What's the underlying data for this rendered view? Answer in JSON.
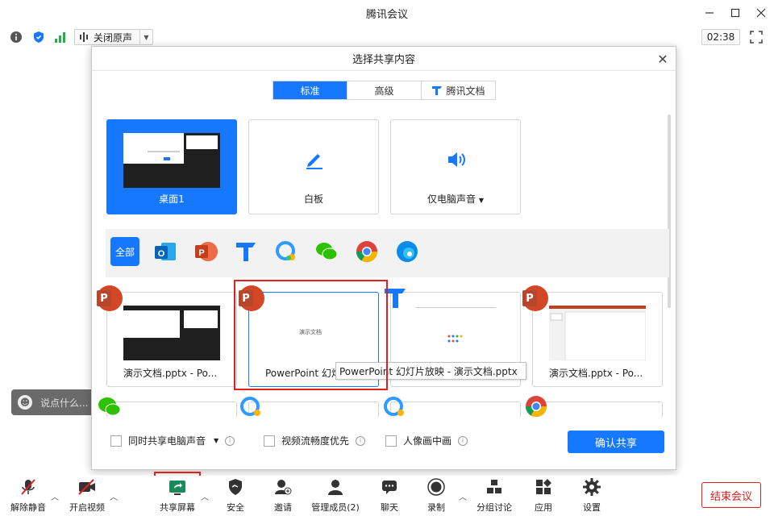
{
  "window": {
    "title": "腾讯会议"
  },
  "toolbar": {
    "noise_label": "关闭原声",
    "timer": "02:38"
  },
  "chat": {
    "placeholder": "说点什么..."
  },
  "dialog": {
    "title": "选择共享内容",
    "tabs": [
      {
        "label": "标准",
        "active": true
      },
      {
        "label": "高级",
        "active": false
      },
      {
        "label": "腾讯文档",
        "active": false
      }
    ],
    "top_cards": [
      {
        "label": "桌面1",
        "selected": true
      },
      {
        "label": "白板"
      },
      {
        "label": "仅电脑声音"
      }
    ],
    "filters": {
      "all_label": "全部",
      "apps": [
        "outlook-icon",
        "powerpoint-icon",
        "tencent-docs-icon",
        "qq-browser-icon",
        "wechat-icon",
        "chrome-icon",
        "edge-icon"
      ]
    },
    "windows": [
      {
        "label": "演示文档.pptx - Po..."
      },
      {
        "label": "PowerPoint 幻灯"
      },
      {
        "label": ""
      },
      {
        "label": "演示文档.pptx - Po..."
      }
    ],
    "tooltip": "PowerPoint 幻灯片放映  -  演示文档.pptx",
    "thumb_text": "演示文档",
    "options": {
      "share_audio": "同时共享电脑声音",
      "video_smooth": "视频流畅度优先",
      "pip": "人像画中画"
    },
    "confirm": "确认共享"
  },
  "bottombar": {
    "items": [
      "解除静音",
      "开启视频",
      "共享屏幕",
      "安全",
      "邀请",
      "管理成员(2)",
      "聊天",
      "录制",
      "分组讨论",
      "应用",
      "设置"
    ],
    "end": "结束会议"
  },
  "colors": {
    "accent": "#1677ff",
    "danger": "#e02020"
  }
}
